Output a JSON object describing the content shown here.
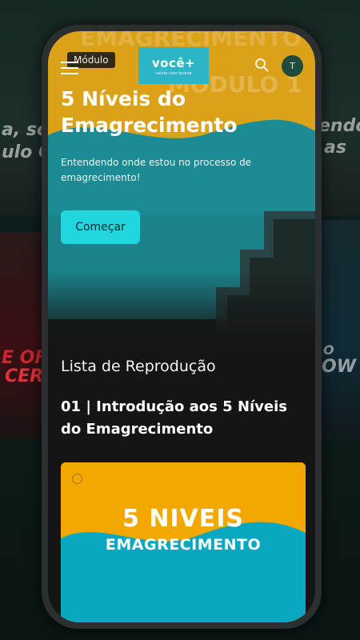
{
  "background": {
    "top_watermark": "EMAGRECIMENTO",
    "left_caption": "a, sou",
    "left_caption2": "ulo Co",
    "right_caption": "endo",
    "right_caption2": "as",
    "left_poster_text": "E OF",
    "left_poster_text2": "CER",
    "right_poster_text": "O",
    "right_poster_text2": "OW"
  },
  "header": {
    "module_badge": "Módulo",
    "logo_text": "você+",
    "logo_subtext": "saúde com leveza",
    "avatar_initial": "T",
    "menu_icon": "hamburger-icon",
    "search_icon": "search-icon"
  },
  "hero": {
    "watermark_top": "EMAGRECIMENTO",
    "watermark_module": "MÓDULO 1",
    "title": "5 Níveis do Emagrecimento",
    "description": "Entendendo onde estou no processo de emagrecimento!",
    "start_button": "Começar"
  },
  "playlist": {
    "heading": "Lista de Reprodução",
    "episode_title": "01 | Introdução aos 5 Níveis do Emagrecimento",
    "thumbnail_line1": "5 NIVEIS",
    "thumbnail_line2": "EMAGRECIMENTO"
  },
  "colors": {
    "accent": "#22d6e0",
    "orange": "#dba119",
    "teal": "#1b8c96"
  }
}
